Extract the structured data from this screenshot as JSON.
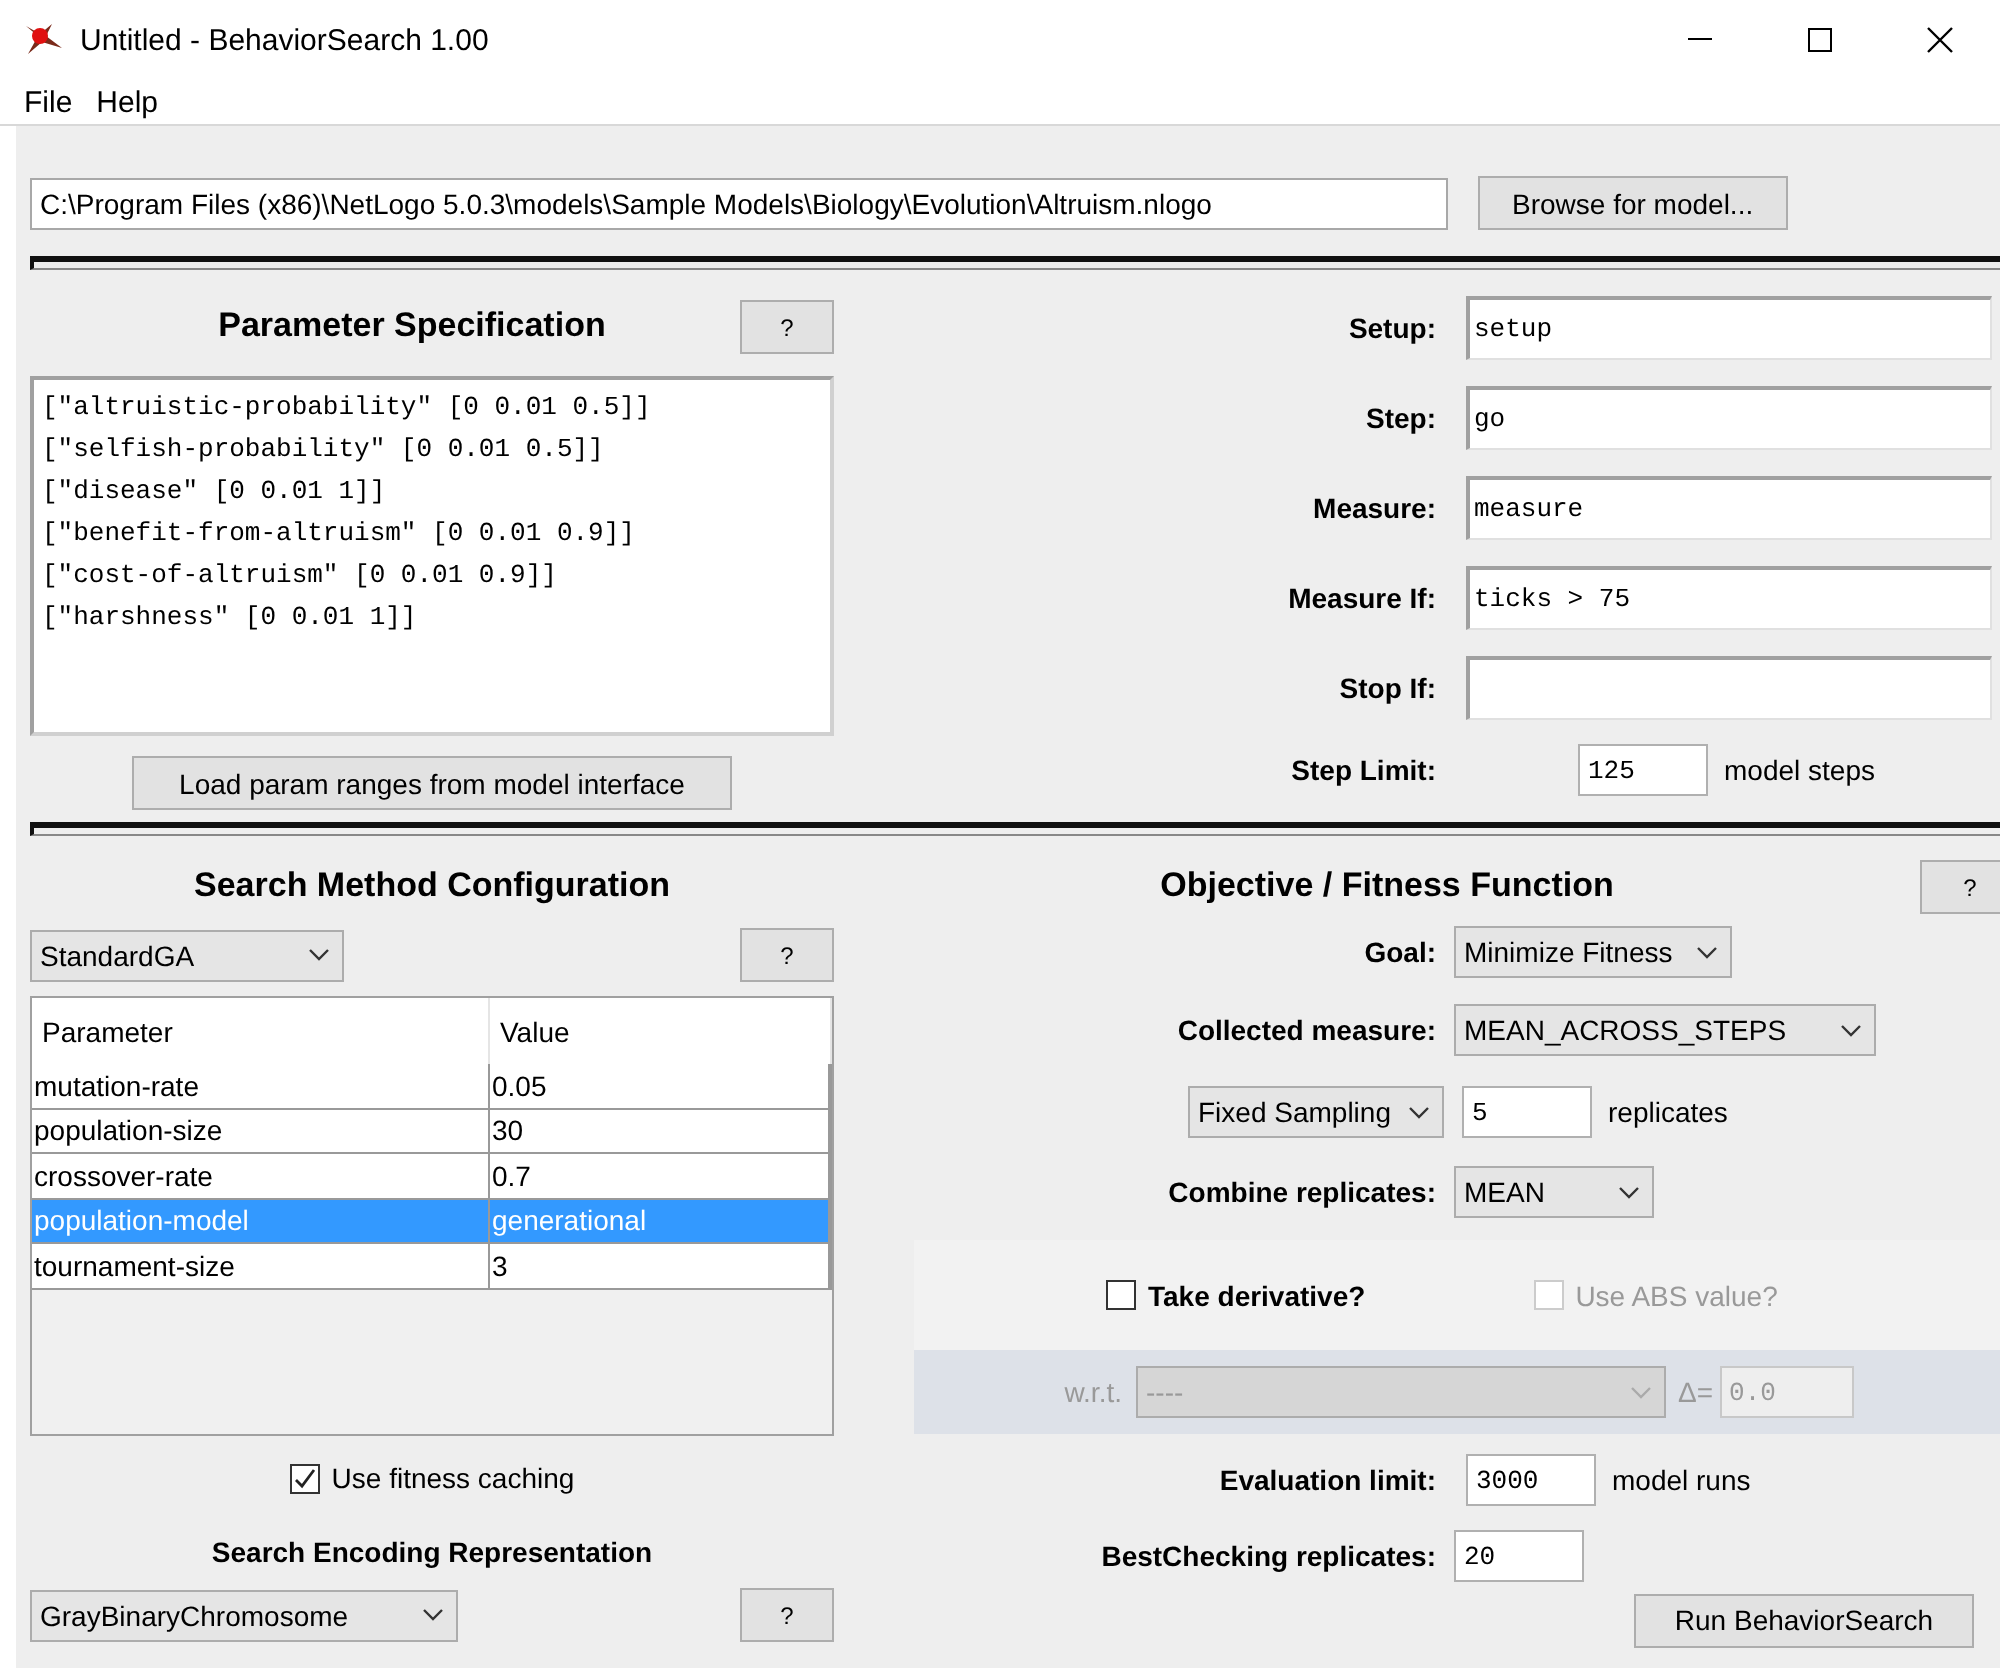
{
  "window": {
    "title": "Untitled - BehaviorSearch 1.00"
  },
  "menu": [
    "File",
    "Help"
  ],
  "model": {
    "path": "C:\\Program Files (x86)\\NetLogo 5.0.3\\models\\Sample Models\\Biology\\Evolution\\Altruism.nlogo",
    "browse_button": "Browse for model..."
  },
  "parameter_spec": {
    "title": "Parameter Specification",
    "help": "?",
    "lines": [
      "[\"altruistic-probability\" [0 0.01 0.5]]",
      "[\"selfish-probability\" [0 0.01 0.5]]",
      "[\"disease\" [0 0.01 1]]",
      "[\"benefit-from-altruism\" [0 0.01 0.9]]",
      "[\"cost-of-altruism\" [0 0.01 0.9]]",
      "[\"harshness\" [0 0.01 1]]"
    ],
    "load_button": "Load param ranges from model interface"
  },
  "model_settings": {
    "fields": [
      {
        "label": "Setup:",
        "value": "setup"
      },
      {
        "label": "Step:",
        "value": "go"
      },
      {
        "label": "Measure:",
        "value": "measure"
      },
      {
        "label": "Measure If:",
        "value": "ticks > 75"
      },
      {
        "label": "Stop If:"
      }
    ],
    "step_limit": {
      "label": "Step Limit:",
      "value": "125",
      "unit": "model steps"
    }
  },
  "search_method": {
    "title": "Search Method Configuration",
    "method": "StandardGA",
    "help": "?",
    "table": {
      "columns": [
        "Parameter",
        "Value"
      ],
      "rows": [
        {
          "cells": [
            "mutation-rate",
            "0.05"
          ],
          "selected": false
        },
        {
          "cells": [
            "population-size",
            "30"
          ],
          "selected": false
        },
        {
          "cells": [
            "crossover-rate",
            "0.7"
          ],
          "selected": false
        },
        {
          "cells": [
            "population-model",
            "generational"
          ],
          "selected": true
        },
        {
          "cells": [
            "tournament-size",
            "3"
          ],
          "selected": false
        }
      ]
    },
    "fitness_caching": {
      "label": "Use fitness caching",
      "checked": true
    },
    "encoding_title": "Search Encoding Representation",
    "encoding": "GrayBinaryChromosome",
    "encoding_help": "?"
  },
  "objective": {
    "title": "Objective / Fitness Function",
    "help": "?",
    "goal": {
      "label": "Goal:",
      "value": "Minimize Fitness"
    },
    "collected": {
      "label": "Collected measure:",
      "value": "MEAN_ACROSS_STEPS"
    },
    "sampling": {
      "value": "Fixed Sampling",
      "count": "5",
      "unit": "replicates"
    },
    "combine": {
      "label": "Combine replicates:",
      "value": "MEAN"
    },
    "derivative": {
      "label": "Take derivative?",
      "checked": false
    },
    "abs": {
      "label": "Use ABS value?",
      "checked": false,
      "disabled": true
    },
    "wrt": {
      "label": "w.r.t.",
      "value": "----",
      "delta_label": "Δ=",
      "delta": "0.0",
      "disabled": true
    },
    "evaluation": {
      "label": "Evaluation limit:",
      "value": "3000",
      "unit": "model runs"
    },
    "best_checking": {
      "label": "BestChecking replicates:",
      "value": "20"
    },
    "run_button": "Run BehaviorSearch"
  }
}
